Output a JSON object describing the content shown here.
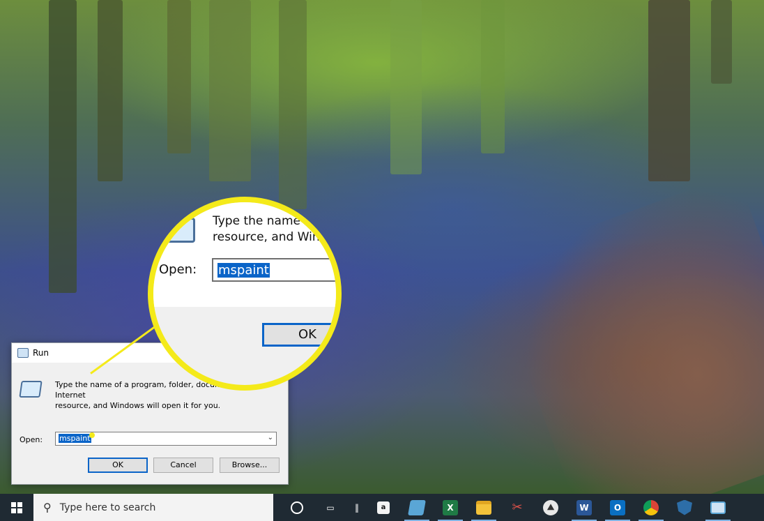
{
  "run_dialog": {
    "title": "Run",
    "description_line1": "Type the name of a program, folder, document, or Internet",
    "description_line2": "resource, and Windows will open it for you.",
    "open_label": "Open:",
    "input_value": "mspaint",
    "buttons": {
      "ok": "OK",
      "cancel": "Cancel",
      "browse": "Browse..."
    }
  },
  "magnifier": {
    "description_line1": "Type the name o",
    "description_line2": "resource, and Wind",
    "open_label": "Open:",
    "input_value": "mspaint",
    "ok_label": "OK",
    "border_color": "#f4ea1a"
  },
  "taskbar": {
    "search_placeholder": "Type here to search",
    "icons": [
      "windows-start-icon",
      "search-icon",
      "cortana-icon",
      "task-view-icon",
      "separator-icon",
      "amazon-icon",
      "paint-icon",
      "excel-icon",
      "file-explorer-icon",
      "snipping-icon",
      "photos-icon",
      "word-icon",
      "outlook-icon",
      "chrome-icon",
      "defender-icon",
      "run-icon"
    ],
    "amazon_glyph": "a",
    "excel_glyph": "X",
    "word_glyph": "W",
    "outlook_glyph": "O"
  },
  "colors": {
    "accent": "#0a64c8",
    "callout": "#f4ea1a",
    "taskbar": "#1f2a33"
  }
}
